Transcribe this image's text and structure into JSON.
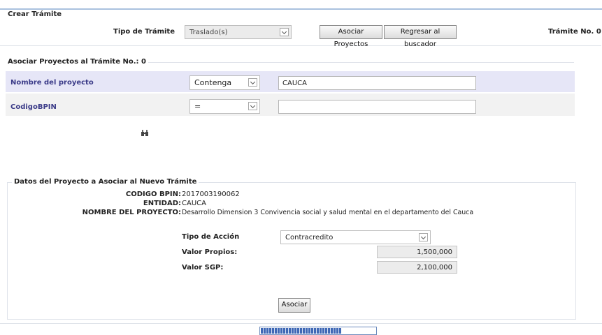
{
  "crear_tramite": {
    "legend": "Crear Trámite",
    "tipo_label": "Tipo de Trámite",
    "tipo_value": "Traslado(s)",
    "asociar_btn": "Asociar Proyectos",
    "regresar_btn": "Regresar al buscador",
    "tramite_no": "Trámite No. 0"
  },
  "asociar": {
    "legend": "Asociar Proyectos al Trámite No.: 0",
    "filters": [
      {
        "label": "Nombre del proyecto",
        "operator": "Contenga",
        "value": "CAUCA"
      },
      {
        "label": "CodigoBPIN",
        "operator": "=",
        "value": ""
      }
    ],
    "search_icon": "binoculars-icon"
  },
  "datos": {
    "legend": "Datos del Proyecto a Asociar al Nuevo Trámite",
    "bpin_label": "CODIGO BPIN:",
    "bpin_value": "2017003190062",
    "entidad_label": "ENTIDAD:",
    "entidad_value": "CAUCA",
    "nombre_label": "NOMBRE DEL PROYECTO:",
    "nombre_value": "Desarrollo Dimension 3 Convivencia social y salud mental en el departamento del Cauca",
    "accion_label": "Tipo de Acción",
    "accion_value": "Contracredito",
    "propios_label": "Valor Propios:",
    "propios_value": "1,500,000",
    "sgp_label": "Valor SGP:",
    "sgp_value": "2,100,000",
    "asociar_btn": "Asociar"
  },
  "loading": {
    "progress_fraction": 0.7
  }
}
